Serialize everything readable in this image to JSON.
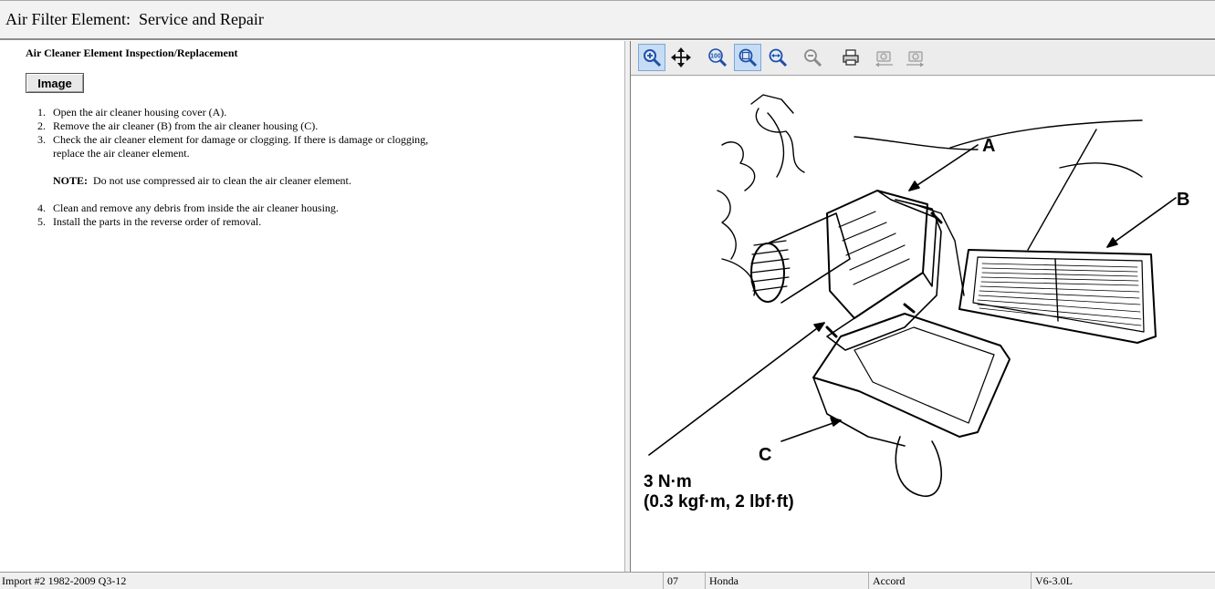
{
  "window": {
    "title": "Air Filter Element:  Service and Repair"
  },
  "document": {
    "heading": "Air Cleaner Element Inspection/Replacement",
    "image_button": "Image",
    "steps": [
      {
        "num": "1.",
        "text": "Open the air cleaner housing cover (A)."
      },
      {
        "num": "2.",
        "text": "Remove the air cleaner (B) from the air cleaner housing (C)."
      },
      {
        "num": "3.",
        "text": "Check the air cleaner element for damage or clogging. If there is damage or clogging,",
        "text2": "replace the air cleaner element."
      },
      {
        "num": "4.",
        "text": "Clean and remove any debris from inside the air cleaner housing."
      },
      {
        "num": "5.",
        "text": "Install the parts in the reverse order of removal."
      }
    ],
    "note_label": "NOTE:",
    "note_text": "  Do not use compressed air to clean the air cleaner element."
  },
  "toolbar": {
    "buttons": [
      {
        "name": "zoom-in",
        "icon": "zoom-in-icon",
        "active": true
      },
      {
        "name": "pan",
        "icon": "pan-icon",
        "active": false
      },
      {
        "name": "zoom-100",
        "icon": "zoom-100-icon",
        "active": false
      },
      {
        "name": "zoom-fit",
        "icon": "zoom-fit-icon",
        "active": true
      },
      {
        "name": "zoom-width",
        "icon": "zoom-width-icon",
        "active": false
      },
      {
        "name": "zoom-out",
        "icon": "zoom-out-icon",
        "active": false
      },
      {
        "name": "print",
        "icon": "print-icon",
        "active": false
      },
      {
        "name": "rotate-left",
        "icon": "rotate-left-icon",
        "active": false
      },
      {
        "name": "rotate-right",
        "icon": "rotate-right-icon",
        "active": false
      }
    ]
  },
  "diagram": {
    "label_a": "A",
    "label_b": "B",
    "label_c": "C",
    "torque_line1": "3 N·m",
    "torque_line2": "(0.3 kgf·m, 2 lbf·ft)"
  },
  "status_bar": {
    "database": "Import #2 1982-2009 Q3-12",
    "year": "07",
    "make": "Honda",
    "model": "Accord",
    "engine": "V6-3.0L"
  },
  "colors": {
    "toolbar_active": "#c6dcf5",
    "icon_blue": "#1c4fa8"
  }
}
